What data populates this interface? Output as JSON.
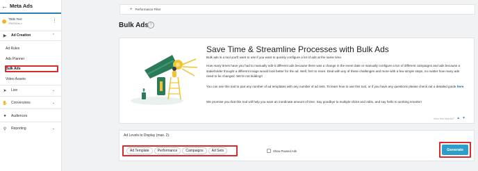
{
  "app": {
    "title": "Meta Ads"
  },
  "account": {
    "name": "TBits Test",
    "id": "2962000xx.x"
  },
  "sidebar": {
    "sections": [
      {
        "label": "Ad Creation",
        "icon": "megaphone-icon"
      },
      {
        "label": "Live",
        "icon": "rocket-icon"
      },
      {
        "label": "Conversions",
        "icon": "handshake-icon"
      },
      {
        "label": "Audiences",
        "icon": "people-icon"
      },
      {
        "label": "Reporting",
        "icon": "magnifier-icon"
      }
    ],
    "ad_creation_items": [
      "Ad Rules",
      "Ads Planner",
      "Bulk Ads",
      "Video Assets"
    ]
  },
  "filter": {
    "label": "Performance Filter"
  },
  "page": {
    "title": "Bulk Ads"
  },
  "info": {
    "title": "Save Time & Streamline Processes with Bulk Ads",
    "p1": "Bulk ads is a tool you'll want to use if you want to quickly configure a lot of ads at the same time.",
    "p2": "How many times have you had to manually edit 5 different ads because there was a change in the event date or manually configure a ton of different campaigns and ads because a stakeholder thought a different image would look better for the ad. Well, fret no more. Deal with any of these challenges and more with a few simple steps, no matter how many ads need to be changed. We're not kidding!!",
    "p3_before": "You can use this tool to pair any number of ad templates with any number of ad sets. To learn how to use this tool, or if you have any questions please check out a detailed guide ",
    "p3_link": "here",
    "p3_after": ".",
    "p4": "We promise you that this tool will help you save an inordinate amount of time. Say goodbye to multiple clicks and edits, and say hello to working smarter!",
    "helpful": "Was this helpful?"
  },
  "generator": {
    "levels_label": "Ad Levels to Display (max. 2):",
    "chips": [
      "Ad Template",
      "Performance",
      "Campaigns",
      "Ad Sets"
    ],
    "show_paused_label": "Show Paused Ads",
    "generate_label": "Generate"
  },
  "colors": {
    "accent": "#2d9ec7",
    "highlight": "#d92b2b",
    "link": "#1a6fb0"
  }
}
